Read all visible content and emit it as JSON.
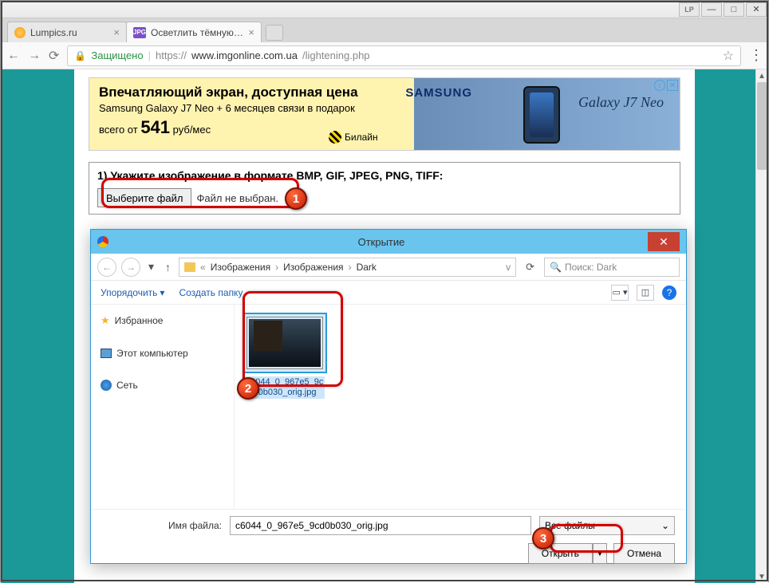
{
  "os": {
    "lp": "LP",
    "min": "—",
    "max": "□",
    "close": "✕"
  },
  "tabs": {
    "tab1": "Lumpics.ru",
    "tab2": "Осветлить тёмную фото",
    "jpg": "JPG"
  },
  "addr": {
    "secure": "Защищено",
    "proto": "https://",
    "host": "www.imgonline.com.ua",
    "path": "/lightening.php"
  },
  "ad": {
    "title": "Впечатляющий экран, доступная цена",
    "sub": "Samsung Galaxy J7 Neo + 6 месяцев связи в подарок",
    "from": "всего от ",
    "price": "541",
    "unit": " руб/мес",
    "brand": "Билайн",
    "samsung": "SAMSUNG",
    "galaxy": "Galaxy J7 Neo"
  },
  "form": {
    "label": "1) Укажите изображение в формате BMP, GIF, JPEG, PNG, TIFF:",
    "choose": "Выберите файл",
    "nofile": "Файл не выбран."
  },
  "dialog": {
    "title": "Открытие",
    "path1": "Изображения",
    "path2": "Изображения",
    "path3": "Dark",
    "searchPlaceholder": "Поиск: Dark",
    "organize": "Упорядочить",
    "newfolder": "Создать папку",
    "fav": "Избранное",
    "pc": "Этот компьютер",
    "net": "Сеть",
    "filename_line1": "c6044_0_967e5_9c",
    "filename_line2": "d0b030_orig.jpg",
    "lblFile": "Имя файла:",
    "fileValue": "c6044_0_967e5_9cd0b030_orig.jpg",
    "typeValue": "Все файлы",
    "open": "Открыть",
    "cancel": "Отмена"
  },
  "badges": {
    "b1": "1",
    "b2": "2",
    "b3": "3"
  }
}
